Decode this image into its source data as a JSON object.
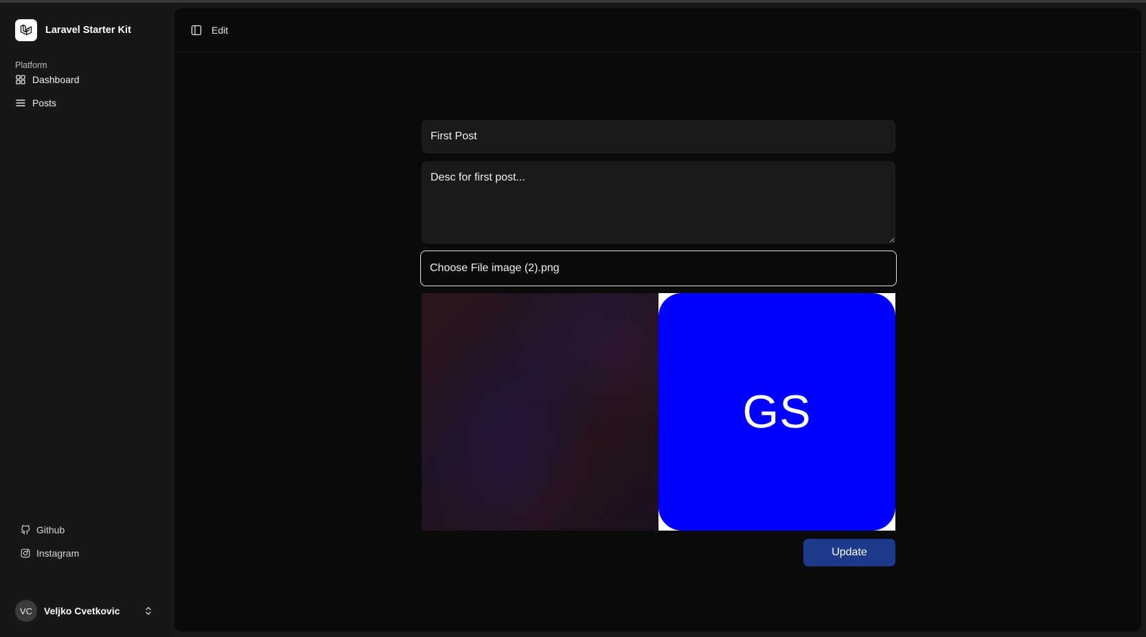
{
  "app": {
    "name": "Laravel Starter Kit"
  },
  "sidebar": {
    "section_label": "Platform",
    "nav": [
      {
        "label": "Dashboard",
        "icon": "grid-icon"
      },
      {
        "label": "Posts",
        "icon": "list-icon"
      }
    ],
    "external_links": [
      {
        "label": "Github",
        "icon": "github-icon"
      },
      {
        "label": "Instagram",
        "icon": "instagram-icon"
      }
    ],
    "user": {
      "initials": "VC",
      "name": "Veljko Cvetkovic"
    }
  },
  "header": {
    "breadcrumb": "Edit"
  },
  "form": {
    "title_value": "First Post",
    "description_value": "Desc for first post...",
    "file_label": "Choose File image (2).png",
    "new_image_text": "GS",
    "new_image_color": "#0000ff",
    "submit_label": "Update",
    "submit_color": "#1e3a8a"
  }
}
